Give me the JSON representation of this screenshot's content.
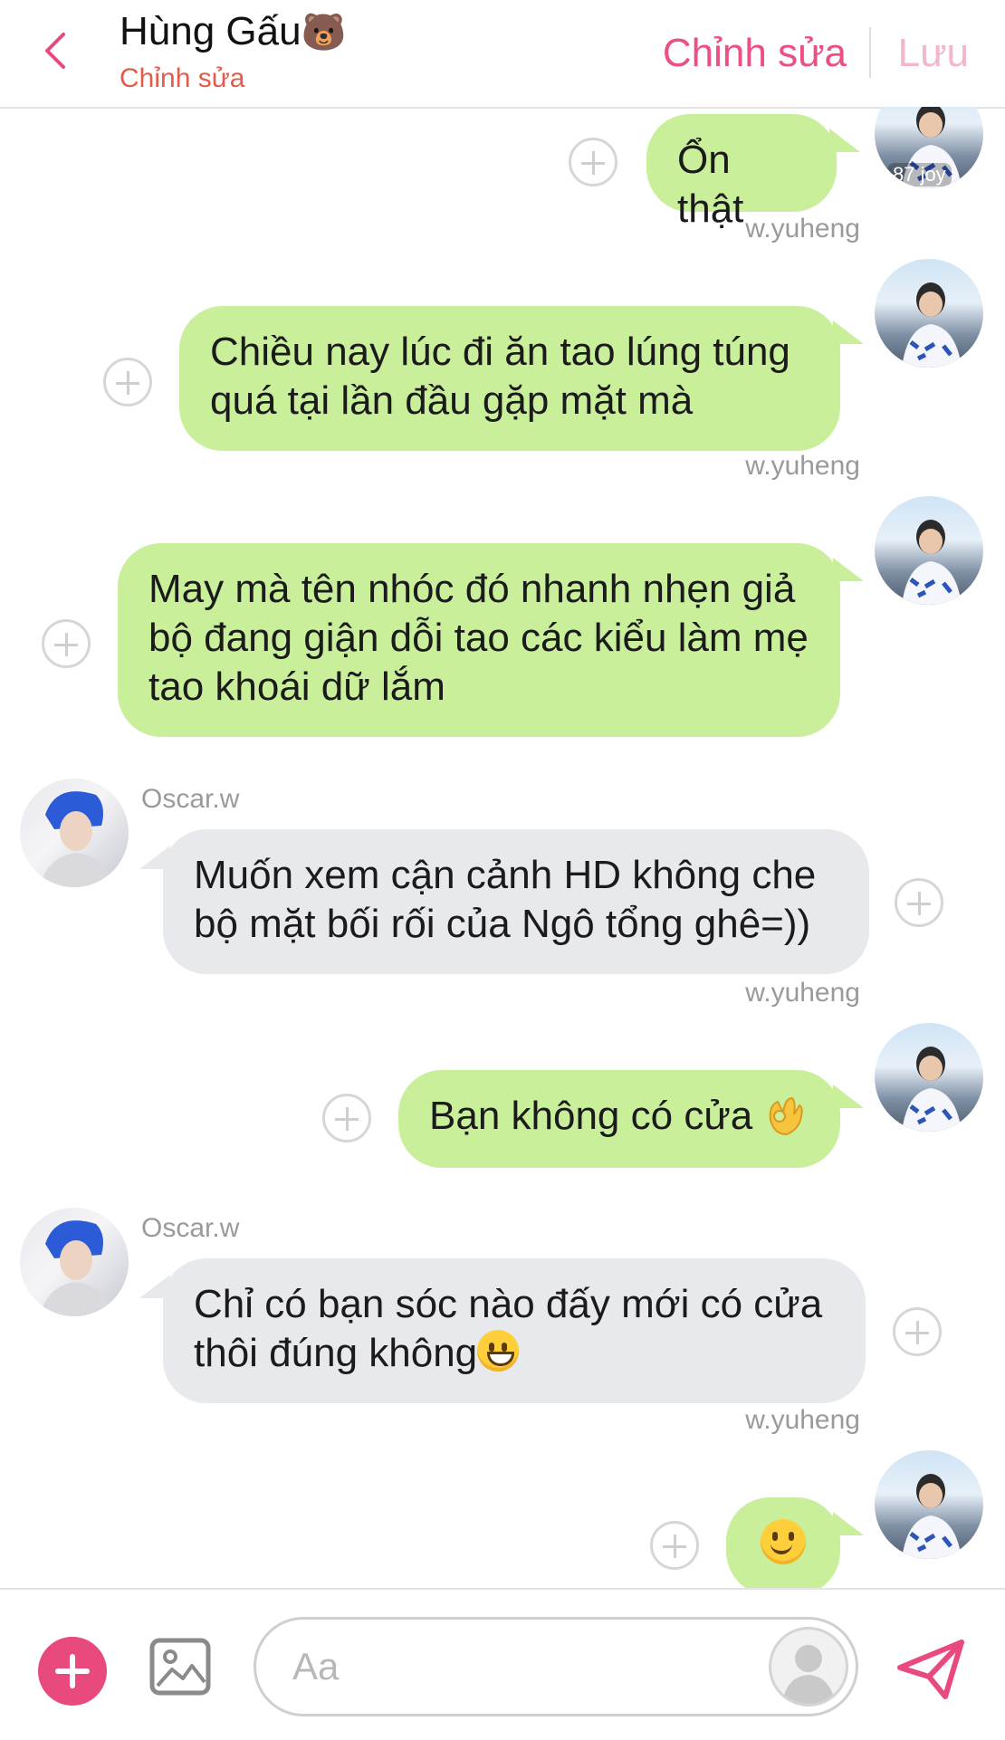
{
  "header": {
    "title": "Hùng Gấu",
    "title_emoji": "🐻",
    "subtitle": "Chỉnh sửa",
    "edit_label": "Chỉnh sửa",
    "save_label": "Lưu"
  },
  "messages": [
    {
      "side": "right",
      "text": "Ổn thật",
      "avatar_caption": "87 joy"
    },
    {
      "side": "right",
      "sender": "w.yuheng",
      "text": "Chiều nay lúc đi ăn tao lúng túng quá tại lần đầu gặp mặt mà"
    },
    {
      "side": "right",
      "sender": "w.yuheng",
      "text": "May mà tên nhóc đó nhanh nhẹn giả bộ đang giận dỗi tao các kiểu làm mẹ tao khoái dữ lắm"
    },
    {
      "side": "left",
      "sender": "Oscar.w",
      "text": "Muốn xem cận cảnh HD không che bộ mặt bối rối của Ngô tổng ghê=))"
    },
    {
      "side": "right",
      "sender": "w.yuheng",
      "text": "Bạn không có cửa",
      "emoji": "ok-hand-icon"
    },
    {
      "side": "left",
      "sender": "Oscar.w",
      "text": "Chỉ có bạn sóc nào đấy mới có cửa thôi đúng không",
      "emoji": "grinning-face-icon"
    },
    {
      "side": "right",
      "sender": "w.yuheng",
      "text": "",
      "emoji": "smiling-face-icon"
    }
  ],
  "composer": {
    "placeholder": "Aa"
  },
  "colors": {
    "accent": "#e94a7d",
    "sent_bubble": "#c9ef9b",
    "received_bubble": "#e8e9ec",
    "subtitle": "#e35b4a"
  }
}
